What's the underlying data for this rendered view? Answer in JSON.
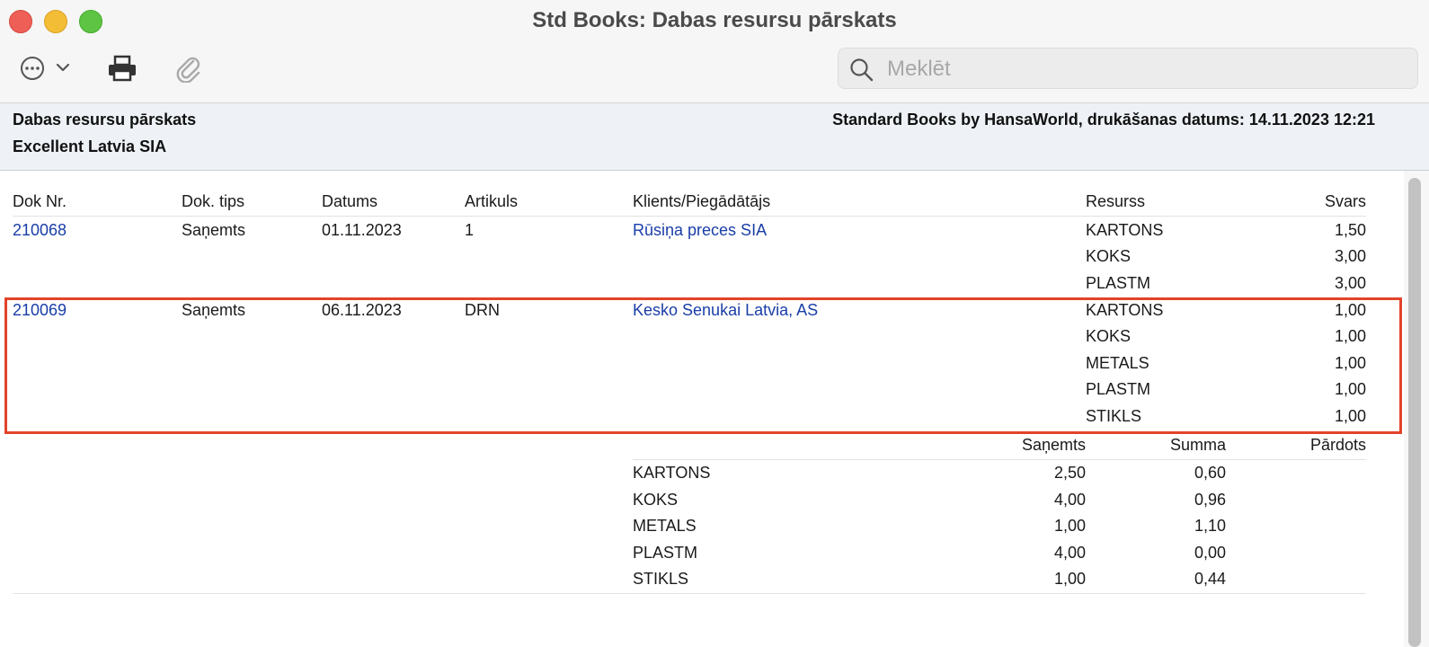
{
  "window": {
    "title": "Std Books: Dabas resursu pārskats"
  },
  "toolbar": {
    "more_icon": "ellipsis-circle-icon",
    "print_icon": "printer-icon",
    "attach_icon": "paperclip-icon",
    "search_placeholder": "Meklēt"
  },
  "report": {
    "title": "Dabas resursu pārskats",
    "company": "Excellent Latvia SIA",
    "printed_info": "Standard Books by HansaWorld, drukāšanas datums: 14.11.2023 12:21"
  },
  "columns": {
    "doc_nr": "Dok Nr.",
    "doc_type": "Dok. tips",
    "date": "Datums",
    "item": "Artikuls",
    "client": "Klients/Piegādātājs",
    "resource": "Resurss",
    "weight": "Svars"
  },
  "documents": [
    {
      "doc_nr": "210068",
      "doc_type": "Saņemts",
      "date": "01.11.2023",
      "item": "1",
      "client": "Rūsiņa preces SIA",
      "resources": [
        {
          "resource": "KARTONS",
          "weight": "1,50"
        },
        {
          "resource": "KOKS",
          "weight": "3,00"
        },
        {
          "resource": "PLASTM",
          "weight": "3,00"
        }
      ]
    },
    {
      "doc_nr": "210069",
      "doc_type": "Saņemts",
      "date": "06.11.2023",
      "item": "DRN",
      "client": "Kesko Senukai Latvia, AS",
      "resources": [
        {
          "resource": "KARTONS",
          "weight": "1,00"
        },
        {
          "resource": "KOKS",
          "weight": "1,00"
        },
        {
          "resource": "METALS",
          "weight": "1,00"
        },
        {
          "resource": "PLASTM",
          "weight": "1,00"
        },
        {
          "resource": "STIKLS",
          "weight": "1,00"
        }
      ]
    }
  ],
  "summary": {
    "columns": {
      "received": "Saņemts",
      "sum": "Summa",
      "sold": "Pārdots"
    },
    "rows": [
      {
        "resource": "KARTONS",
        "received": "2,50",
        "sum": "0,60"
      },
      {
        "resource": "KOKS",
        "received": "4,00",
        "sum": "0,96"
      },
      {
        "resource": "METALS",
        "received": "1,00",
        "sum": "1,10"
      },
      {
        "resource": "PLASTM",
        "received": "4,00",
        "sum": "0,00"
      },
      {
        "resource": "STIKLS",
        "received": "1,00",
        "sum": "0,44"
      }
    ]
  },
  "colors": {
    "link": "#1a3ea8",
    "highlight": "#e2432a",
    "header_bg": "#eef2f7"
  }
}
